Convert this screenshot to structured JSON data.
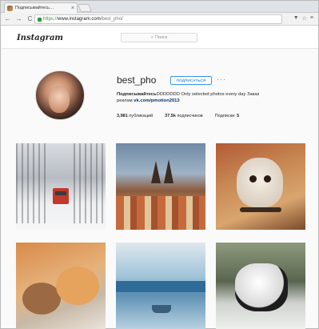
{
  "browser": {
    "tab_title": "Подписывайтесь…",
    "tab_close": "×",
    "nav_back": "←",
    "nav_forward": "→",
    "nav_reload": "C",
    "url_scheme": "https://",
    "url_host": "www.instagram.com",
    "url_path": "/best_pho/",
    "right_icons": [
      "▼",
      "☆",
      "≡"
    ]
  },
  "instagram": {
    "logo_text": "Instagram",
    "search_placeholder": "Поиск",
    "search_icon": "⌕"
  },
  "profile": {
    "username": "best_pho",
    "follow_label": "ПОДПИСАТЬСЯ",
    "more_label": "···",
    "bio_bold": "Подписывайтесь",
    "bio_line1_rest": "DDDDDDD Only selected photos every day Заказ",
    "bio_line2_start": "реклам",
    "bio_link": "vk.com/pmotion2013",
    "stats": {
      "posts_count": "3,981",
      "posts_label": "публикаций",
      "followers_count": "37.5k",
      "followers_label": "подписчиков",
      "following_label": "Подписки:",
      "following_count": "5"
    }
  },
  "grid": {
    "photos": [
      {
        "subject": "snowy-avenue-red-tram"
      },
      {
        "subject": "prague-old-town"
      },
      {
        "subject": "dog-with-collar"
      },
      {
        "subject": "rabbits"
      },
      {
        "subject": "frozen-lake-boat"
      },
      {
        "subject": "fluffy-dog-in-snow"
      }
    ]
  }
}
